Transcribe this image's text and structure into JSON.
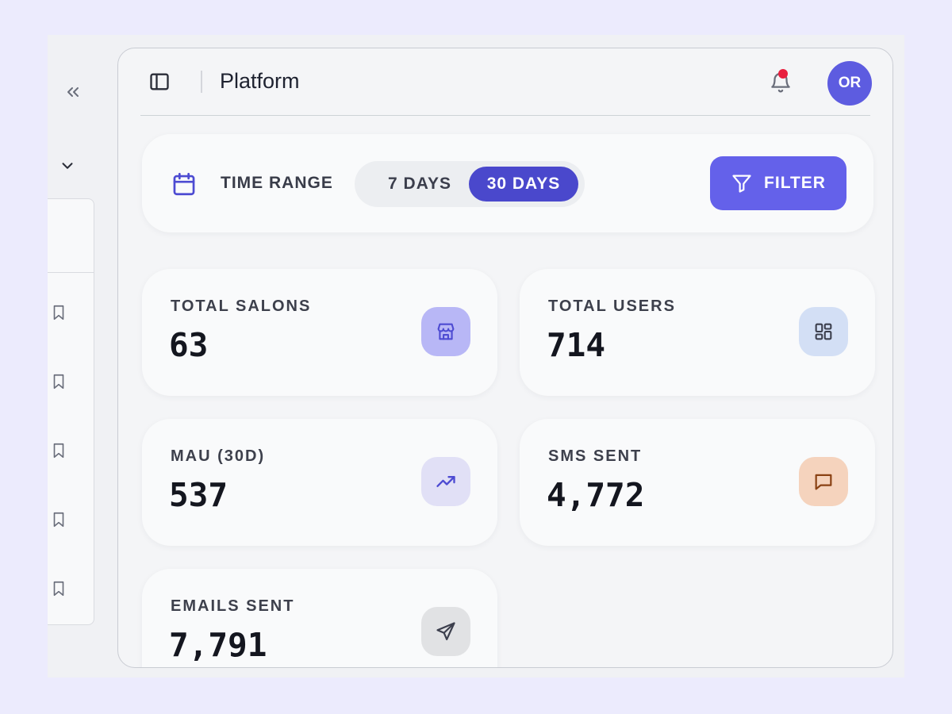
{
  "header": {
    "title": "Platform",
    "avatar_initials": "OR"
  },
  "filter_bar": {
    "time_range_label": "TIME RANGE",
    "options": [
      "7 DAYS",
      "30 DAYS"
    ],
    "selected": "30 DAYS",
    "filter_label": "FILTER"
  },
  "stats": [
    {
      "label": "TOTAL SALONS",
      "value": "63",
      "icon": "store-icon",
      "color": "#b8b7f6"
    },
    {
      "label": "TOTAL USERS",
      "value": "714",
      "icon": "grid-icon",
      "color": "#d3dff5"
    },
    {
      "label": "MAU (30D)",
      "value": "537",
      "icon": "trending-up-icon",
      "color": "#e1e0f6"
    },
    {
      "label": "SMS SENT",
      "value": "4,772",
      "icon": "message-icon",
      "color": "#f5d3bd"
    },
    {
      "label": "EMAILS SENT",
      "value": "7,791",
      "icon": "send-icon",
      "color": "#e1e2e4"
    }
  ],
  "colors": {
    "accent": "#6461ea",
    "selected_segment": "#4a48cc",
    "notification_dot": "#e8203f"
  }
}
